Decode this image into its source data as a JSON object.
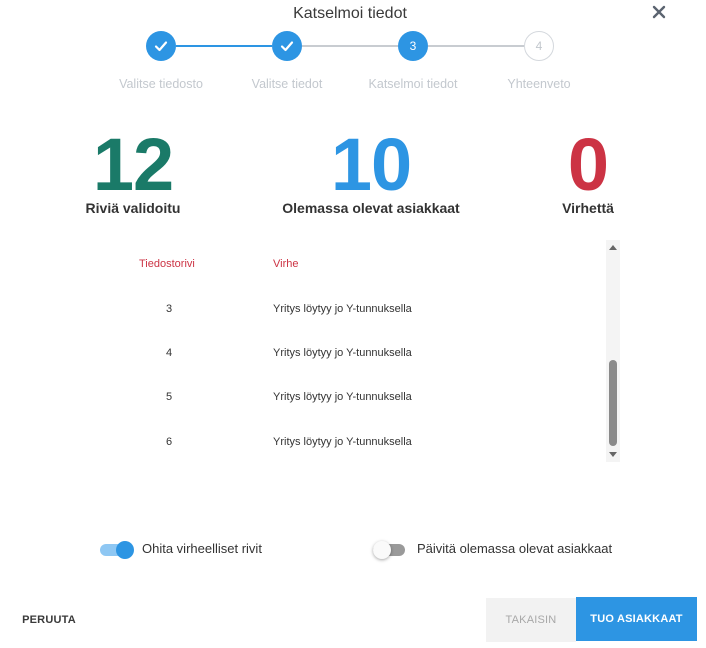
{
  "dialog": {
    "title": "Katselmoi tiedot"
  },
  "steps": [
    {
      "label": "Valitse tiedosto",
      "state": "done",
      "number": ""
    },
    {
      "label": "Valitse tiedot",
      "state": "done",
      "number": ""
    },
    {
      "label": "Katselmoi tiedot",
      "state": "active",
      "number": "3"
    },
    {
      "label": "Yhteenveto",
      "state": "pending",
      "number": "4"
    }
  ],
  "stats": [
    {
      "value": "12",
      "label": "Riviä validoitu",
      "color": "#1a7a68"
    },
    {
      "value": "10",
      "label": "Olemassa olevat asiakkaat",
      "color": "#2d95e3"
    },
    {
      "value": "0",
      "label": "Virhettä",
      "color": "#cc3344"
    }
  ],
  "table": {
    "headers": {
      "row": "Tiedostorivi",
      "error": "Virhe"
    },
    "rows": [
      {
        "row": "3",
        "error": "Yritys löytyy jo Y-tunnuksella"
      },
      {
        "row": "4",
        "error": "Yritys löytyy jo Y-tunnuksella"
      },
      {
        "row": "5",
        "error": "Yritys löytyy jo Y-tunnuksella"
      },
      {
        "row": "6",
        "error": "Yritys löytyy jo Y-tunnuksella"
      }
    ]
  },
  "toggles": [
    {
      "label": "Ohita virheelliset rivit",
      "checked": true
    },
    {
      "label": "Päivitä olemassa olevat asiakkaat",
      "checked": false
    }
  ],
  "buttons": {
    "cancel": "PERUUTA",
    "back": "TAKAISIN",
    "import": "TUO ASIAKKAAT"
  },
  "colors": {
    "accent": "#2d95e3",
    "validated": "#1a7a68",
    "error": "#cc3344"
  }
}
